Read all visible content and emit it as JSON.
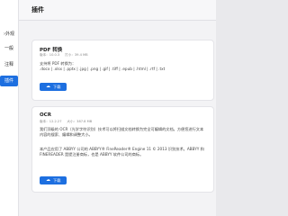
{
  "sidebar": {
    "items": [
      {
        "label": "外观",
        "prefix": "›"
      },
      {
        "label": "一般"
      },
      {
        "label": "注释"
      },
      {
        "label": "插件"
      }
    ],
    "active_index": 3
  },
  "header": {
    "title": "插件"
  },
  "plugins": [
    {
      "name": "PDF 转换",
      "meta": "版本：10.0.3 　 打小：39.4 MB",
      "desc1": "支持将 PDF 转换为：",
      "desc2": ".docx | .xlsx | .pptx | .jpg | .png | .gif | .tiff | .epub | .html | .rtf | .txt",
      "button": "下载",
      "button_icon": "download-cloud-icon"
    },
    {
      "name": "OCR",
      "meta": "版本：12.2.27 　 大小：387.8 MB",
      "desc1": "我们顶级的 OCR（光学字符识别）技术可以将扫描文档转换为完全可编辑的文档。方便您进行文本内容的搜索、编辑和调整大小。",
      "desc2": "本产品应用了 ABBYY 公司的 ABBYY® FineReader® Engine 11 © 2013 识别技术。ABBYY 和 FINEREADER 是提注册商标，也是 ABBYY 软件公司的商标。",
      "button": "下载",
      "button_icon": "download-cloud-icon"
    }
  ],
  "colors": {
    "accent": "#1d6fe0"
  }
}
